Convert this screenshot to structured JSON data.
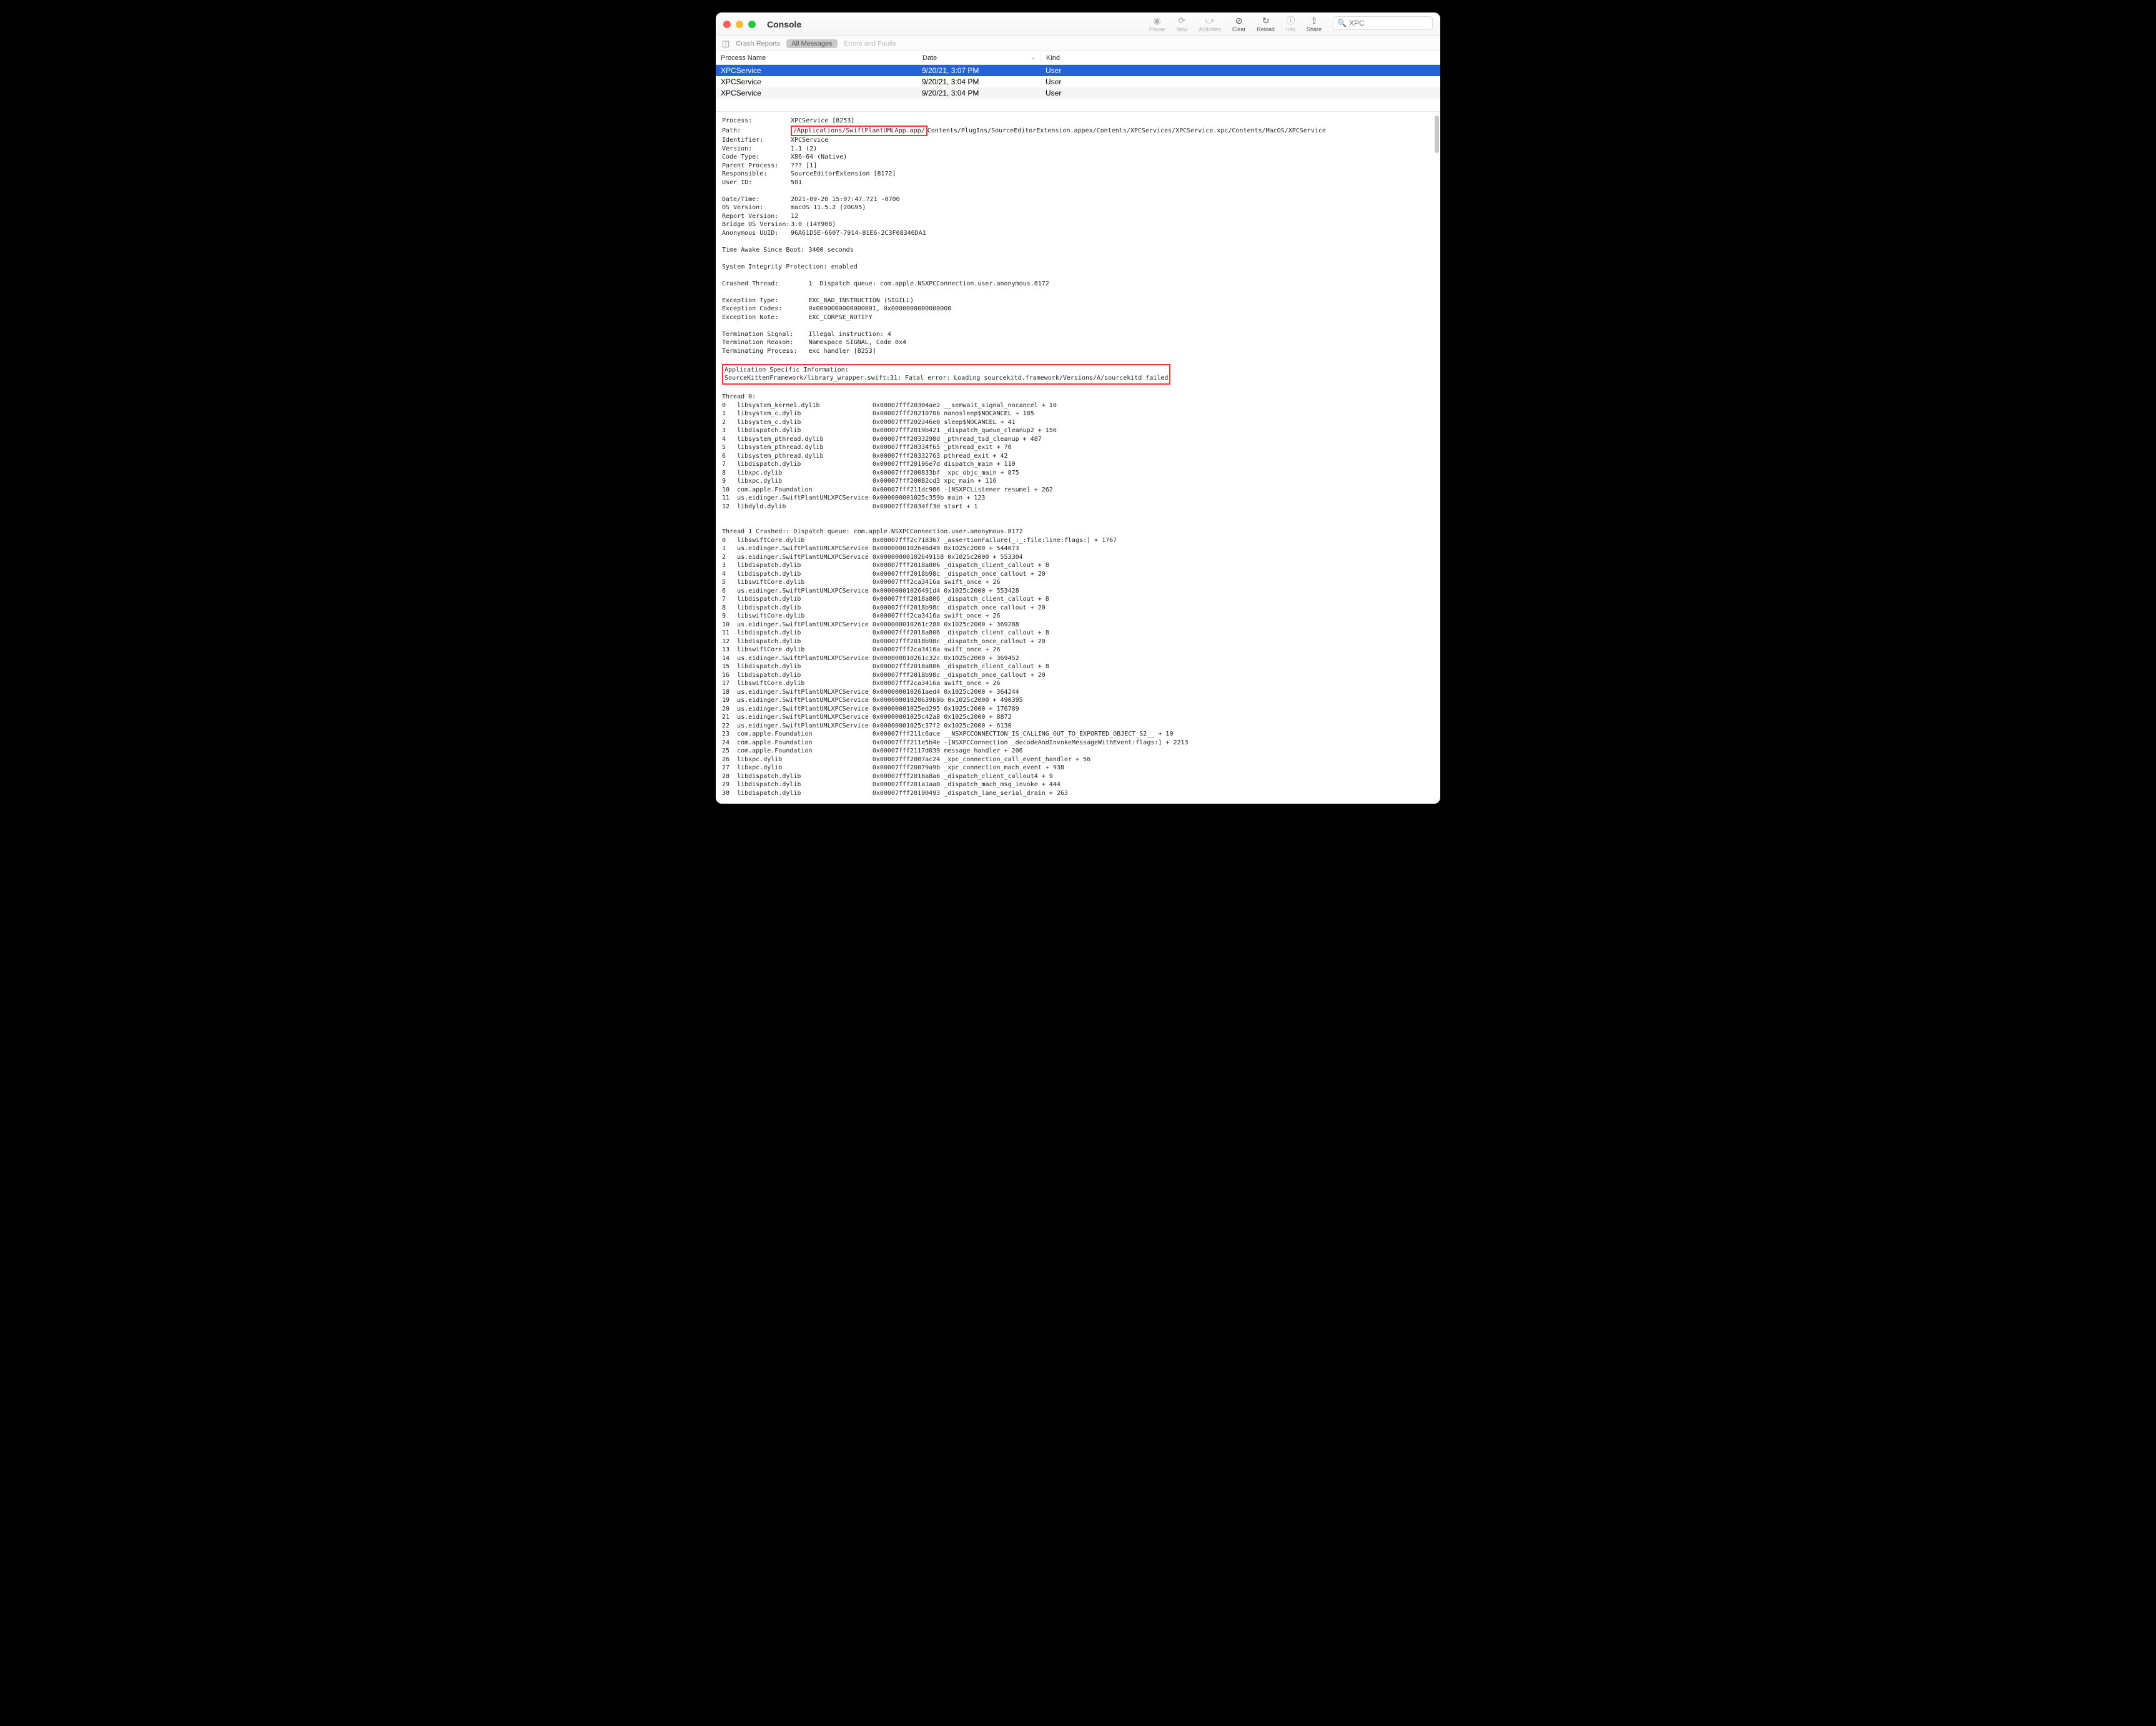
{
  "app": {
    "title": "Console"
  },
  "toolbar": {
    "pause": "Pause",
    "now": "Now",
    "activities": "Activities",
    "clear": "Clear",
    "reload": "Reload",
    "info": "Info",
    "share": "Share"
  },
  "search": {
    "value": "XPC"
  },
  "subbar": {
    "crash_reports": "Crash Reports",
    "all_messages": "All Messages",
    "errors_and_faults": "Errors and Faults"
  },
  "columns": {
    "process": "Process Name",
    "date": "Date",
    "kind": "Kind"
  },
  "rows": [
    {
      "process": "XPCService",
      "date": "9/20/21, 3:07 PM",
      "kind": "User"
    },
    {
      "process": "XPCService",
      "date": "9/20/21, 3:04 PM",
      "kind": "User"
    },
    {
      "process": "XPCService",
      "date": "9/20/21, 3:04 PM",
      "kind": "User"
    }
  ],
  "detail": {
    "process_label": "Process:",
    "process_value": "XPCService [8253]",
    "path_label": "Path:",
    "path_highlight": "/Applications/SwiftPlantUMLApp.app/",
    "path_rest": "Contents/PlugIns/SourceEditorExtension.appex/Contents/XPCServices/XPCService.xpc/Contents/MacOS/XPCService",
    "identifier_label": "Identifier:",
    "identifier_value": "XPCService",
    "version_label": "Version:",
    "version_value": "1.1 (2)",
    "codetype_label": "Code Type:",
    "codetype_value": "X86-64 (Native)",
    "parent_label": "Parent Process:",
    "parent_value": "??? [1]",
    "responsible_label": "Responsible:",
    "responsible_value": "SourceEditorExtension [8172]",
    "userid_label": "User ID:",
    "userid_value": "501",
    "datetime_label": "Date/Time:",
    "datetime_value": "2021-09-20 15:07:47.721 -0700",
    "osversion_label": "OS Version:",
    "osversion_value": "macOS 11.5.2 (20G95)",
    "reportver_label": "Report Version:",
    "reportver_value": "12",
    "bridgeos_label": "Bridge OS Version:",
    "bridgeos_value": "3.0 (14Y908)",
    "anonuuid_label": "Anonymous UUID:",
    "anonuuid_value": "96A61D5E-6607-7914-81E6-2C3F08346DA1",
    "timeawake": "Time Awake Since Boot: 3400 seconds",
    "sip": "System Integrity Protection: enabled",
    "crashed_thread": "Crashed Thread:        1  Dispatch queue: com.apple.NSXPCConnection.user.anonymous.8172",
    "exc_type": "Exception Type:        EXC_BAD_INSTRUCTION (SIGILL)",
    "exc_codes": "Exception Codes:       0x0000000000000001, 0x0000000000000000",
    "exc_note": "Exception Note:        EXC_CORPSE_NOTIFY",
    "term_signal": "Termination Signal:    Illegal instruction: 4",
    "term_reason": "Termination Reason:    Namespace SIGNAL, Code 0x4",
    "term_process": "Terminating Process:   exc handler [8253]",
    "asi_header": "Application Specific Information:",
    "asi_body": "SourceKittenFramework/library_wrapper.swift:31: Fatal error: Loading sourcekitd.framework/Versions/A/sourcekitd failed",
    "thread0_header": "Thread 0:",
    "thread0": [
      "0   libsystem_kernel.dylib        \t0x00007fff20304ae2 __semwait_signal_nocancel + 10",
      "1   libsystem_c.dylib             \t0x00007fff2021070b nanosleep$NOCANCEL + 185",
      "2   libsystem_c.dylib             \t0x00007fff202346e0 sleep$NOCANCEL + 41",
      "3   libdispatch.dylib             \t0x00007fff2019b421 _dispatch_queue_cleanup2 + 156",
      "4   libsystem_pthread.dylib       \t0x00007fff2033298d _pthread_tsd_cleanup + 487",
      "5   libsystem_pthread.dylib       \t0x00007fff20334f65 _pthread_exit + 70",
      "6   libsystem_pthread.dylib       \t0x00007fff20332763 pthread_exit + 42",
      "7   libdispatch.dylib             \t0x00007fff20196e7d dispatch_main + 110",
      "8   libxpc.dylib                  \t0x00007fff200833bf _xpc_objc_main + 875",
      "9   libxpc.dylib                  \t0x00007fff20082cd3 xpc_main + 116",
      "10  com.apple.Foundation          \t0x00007fff211dc986 -[NSXPCListener resume] + 262",
      "11  us.eidinger.SwiftPlantUMLXPCService\t0x000000001025c359b main + 123",
      "12  libdyld.dylib                 \t0x00007fff2034ff3d start + 1"
    ],
    "thread1_header": "Thread 1 Crashed:: Dispatch queue: com.apple.NSXPCConnection.user.anonymous.8172",
    "thread1": [
      "0   libswiftCore.dylib            \t0x00007fff2c718367 _assertionFailure(_:_:file:line:flags:) + 1767",
      "1   us.eidinger.SwiftPlantUMLXPCService\t0x0000000102646d49 0x1025c2000 + 544073",
      "2   us.eidinger.SwiftPlantUMLXPCService\t0x00000000102649158 0x1025c2000 + 553304",
      "3   libdispatch.dylib             \t0x00007fff2018a806 _dispatch_client_callout + 8",
      "4   libdispatch.dylib             \t0x00007fff2018b98c _dispatch_once_callout + 20",
      "5   libswiftCore.dylib            \t0x00007fff2ca3416a swift_once + 26",
      "6   us.eidinger.SwiftPlantUMLXPCService\t0x00000001026491d4 0x1025c2000 + 553428",
      "7   libdispatch.dylib             \t0x00007fff2018a806 _dispatch_client_callout + 8",
      "8   libdispatch.dylib             \t0x00007fff2018b98c _dispatch_once_callout + 20",
      "9   libswiftCore.dylib            \t0x00007fff2ca3416a swift_once + 26",
      "10  us.eidinger.SwiftPlantUMLXPCService\t0x000000010261c288 0x1025c2000 + 369288",
      "11  libdispatch.dylib             \t0x00007fff2018a806 _dispatch_client_callout + 8",
      "12  libdispatch.dylib             \t0x00007fff2018b98c _dispatch_once_callout + 20",
      "13  libswiftCore.dylib            \t0x00007fff2ca3416a swift_once + 26",
      "14  us.eidinger.SwiftPlantUMLXPCService\t0x000000010261c32c 0x1025c2000 + 369452",
      "15  libdispatch.dylib             \t0x00007fff2018a806 _dispatch_client_callout + 8",
      "16  libdispatch.dylib             \t0x00007fff2018b98c _dispatch_once_callout + 20",
      "17  libswiftCore.dylib            \t0x00007fff2ca3416a swift_once + 26",
      "18  us.eidinger.SwiftPlantUMLXPCService\t0x000000010261aed4 0x1025c2000 + 364244",
      "19  us.eidinger.SwiftPlantUMLXPCService\t0x00000001020639b9b 0x1025c2000 + 490395",
      "20  us.eidinger.SwiftPlantUMLXPCService\t0x00000001025ed295 0x1025c2000 + 176789",
      "21  us.eidinger.SwiftPlantUMLXPCService\t0x00000001025c42a8 0x1025c2000 + 8872",
      "22  us.eidinger.SwiftPlantUMLXPCService\t0x00000001025c37f2 0x1025c2000 + 6130",
      "23  com.apple.Foundation          \t0x00007fff211c6ace __NSXPCCONNECTION_IS_CALLING_OUT_TO_EXPORTED_OBJECT_S2__ + 10",
      "24  com.apple.Foundation          \t0x00007fff211e5b4e -[NSXPCConnection _decodeAndInvokeMessageWithEvent:flags:] + 2213",
      "25  com.apple.Foundation          \t0x00007fff2117d039 message_handler + 206",
      "26  libxpc.dylib                  \t0x00007fff2007ac24 _xpc_connection_call_event_handler + 56",
      "27  libxpc.dylib                  \t0x00007fff20079a9b _xpc_connection_mach_event + 938",
      "28  libdispatch.dylib             \t0x00007fff2018a8a6 _dispatch_client_callout4 + 9",
      "29  libdispatch.dylib             \t0x00007fff201a1aa0 _dispatch_mach_msg_invoke + 444",
      "30  libdispatch.dylib             \t0x00007fff20190493 _dispatch_lane_serial_drain + 263"
    ]
  }
}
